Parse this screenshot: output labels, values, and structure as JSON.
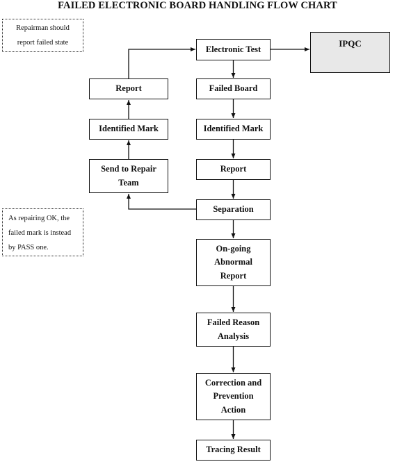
{
  "title": "FAILED ELECTRONIC BOARD HANDLING FLOW CHART",
  "notes": {
    "repairman": "Repairman should\nreport failed state",
    "repairing_ok": "As repairing OK, the\nfailed mark is instead\nby PASS one."
  },
  "main_flow": {
    "electronic_test": "Electronic Test",
    "failed_board": "Failed Board",
    "identified_mark": "Identified Mark",
    "report": "Report",
    "separation": "Separation",
    "ongoing_abnormal_report": "On-going\nAbnormal\nReport",
    "failed_reason_analysis": "Failed Reason\nAnalysis",
    "correction_prevention": "Correction and\nPrevention\nAction",
    "tracing_result": "Tracing Result"
  },
  "repair_flow": {
    "send_to_repair": "Send to Repair\nTeam",
    "identified_mark": "Identified Mark",
    "report": "Report"
  },
  "ipqc": "IPQC",
  "colors": {
    "ipqc_fill": "#e8e8e8",
    "line": "#111111"
  }
}
